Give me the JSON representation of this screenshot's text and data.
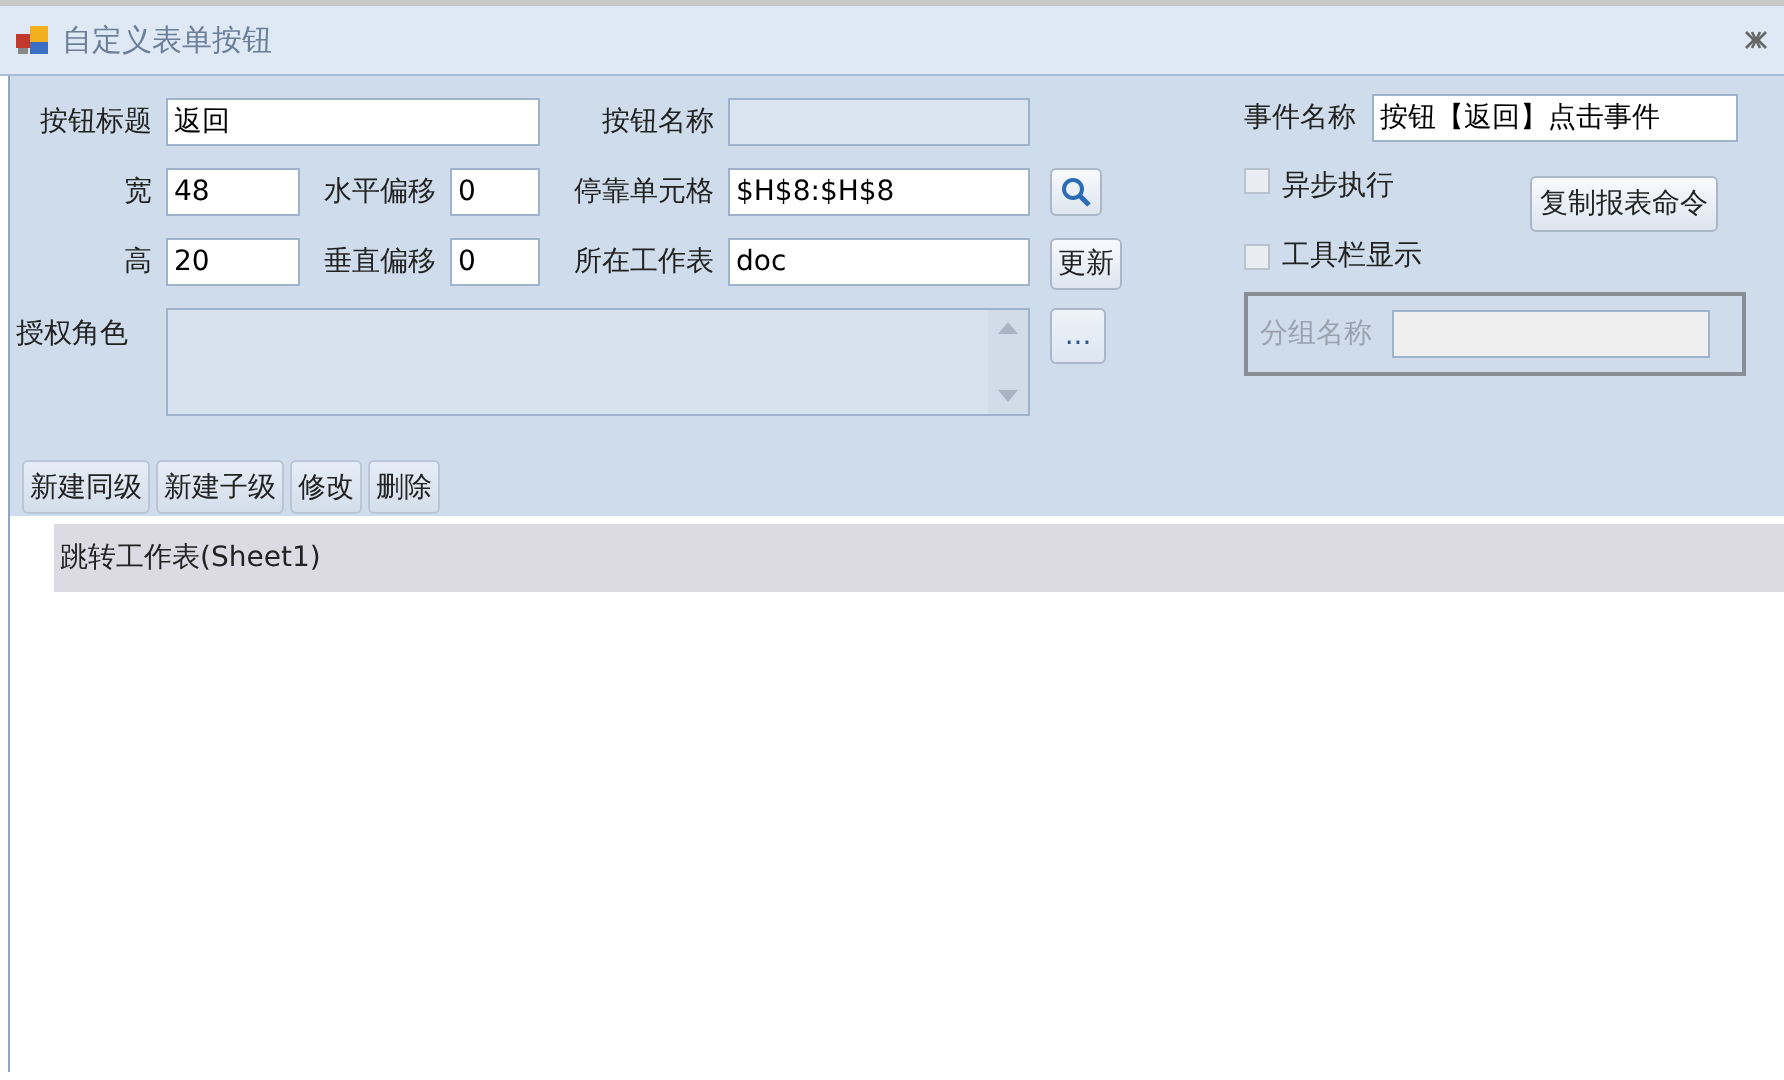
{
  "window": {
    "title": "自定义表单按钮"
  },
  "form": {
    "caption": {
      "label": "按钮标题",
      "value": "返回"
    },
    "name": {
      "label": "按钮名称",
      "disabled": true
    },
    "width": {
      "label": "宽",
      "value": "48"
    },
    "h_offset": {
      "label": "水平偏移",
      "value": "0"
    },
    "anchor_cell": {
      "label": "停靠单元格",
      "value": "$H$8:$H$8"
    },
    "height": {
      "label": "高",
      "value": "20"
    },
    "v_offset": {
      "label": "垂直偏移",
      "value": "0"
    },
    "sheet": {
      "label": "所在工作表",
      "value": "doc"
    },
    "update_button": "更新",
    "roles": {
      "label": "授权角色"
    },
    "more_button": "..."
  },
  "event_name": {
    "label": "事件名称",
    "value": "按钮【返回】点击事件"
  },
  "async": {
    "label": "异步执行",
    "checked": false
  },
  "copy_button": "复制报表命令",
  "toolbar_show": {
    "label": "工具栏显示",
    "checked": false
  },
  "group": {
    "label": "分组名称",
    "disabled": true
  },
  "toolbar": [
    "新建同级",
    "新建子级",
    "修改",
    "删除"
  ],
  "tree": {
    "items": [
      {
        "label": "跳转工作表(Sheet1)",
        "selected": true
      }
    ]
  }
}
